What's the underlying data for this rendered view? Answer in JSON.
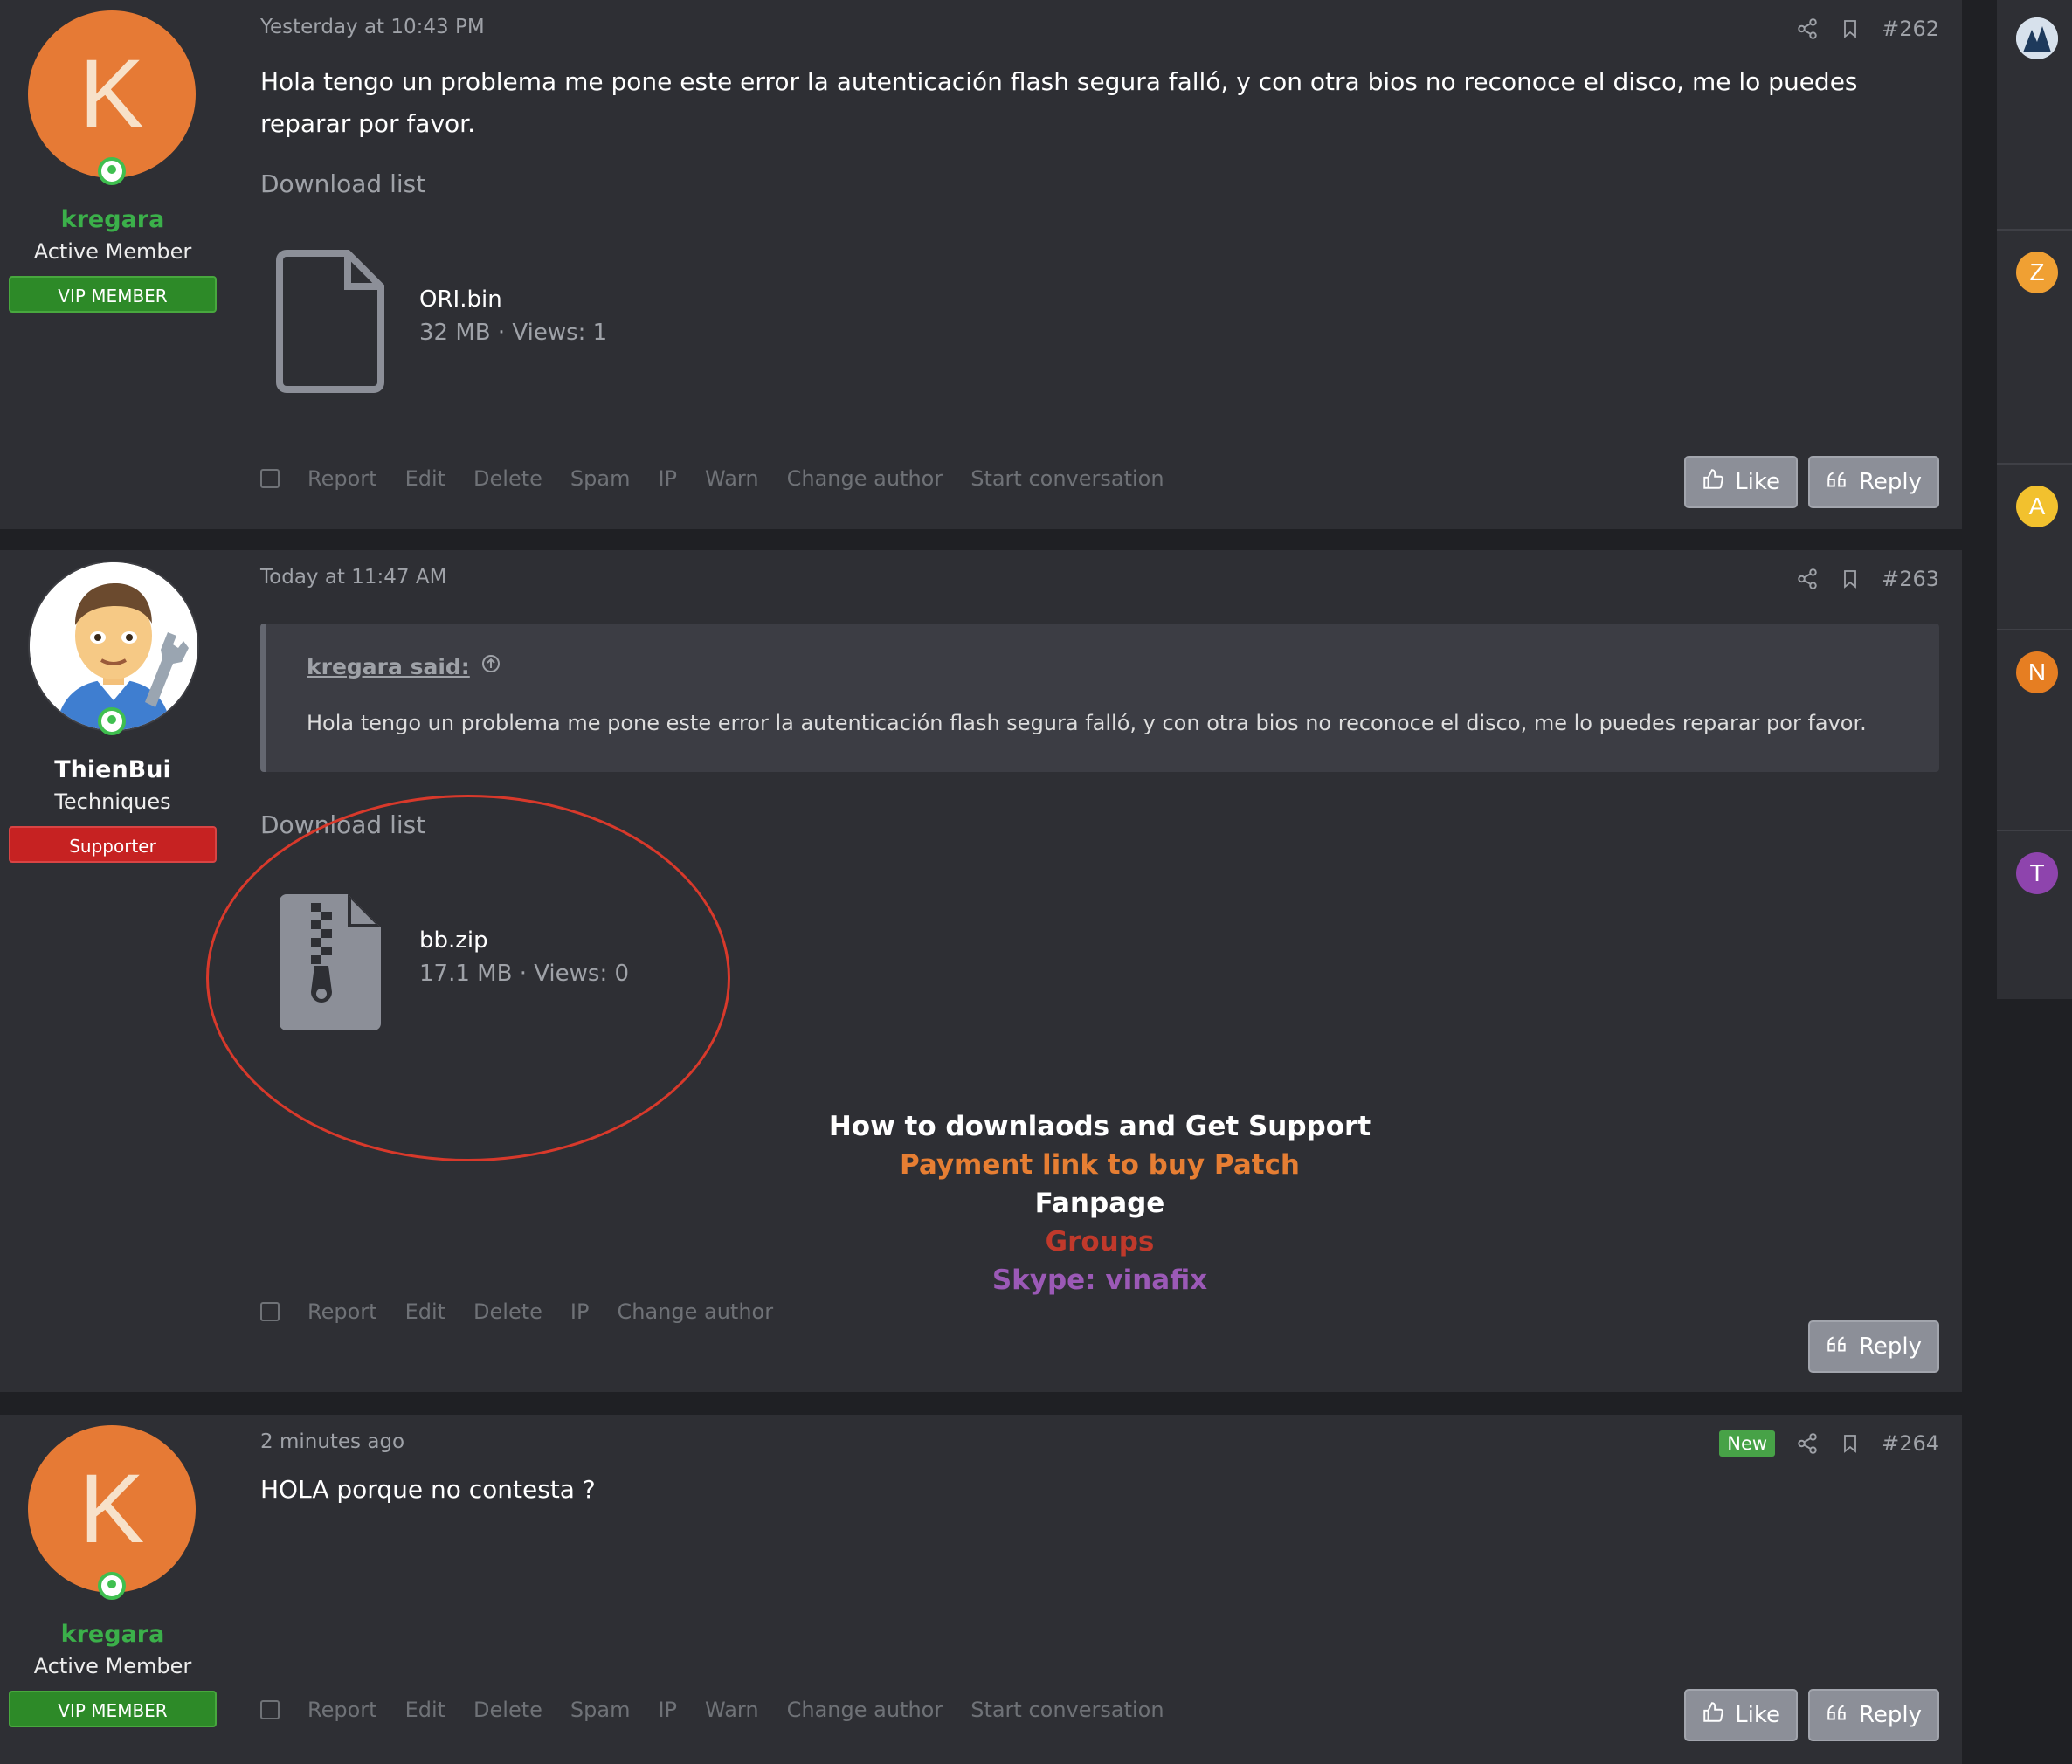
{
  "posts": [
    {
      "user": {
        "initial": "K",
        "name": "kregara",
        "title": "Active Member",
        "badge": "VIP MEMBER"
      },
      "date": "Yesterday at 10:43 PM",
      "number": "#262",
      "message": "Hola tengo un problema me pone este error la autenticación flash segura falló, y con otra bios no reconoce el disco, me lo puedes reparar por favor.",
      "download_title": "Download list",
      "attachment": {
        "name": "ORI.bin",
        "meta": "32 MB · Views: 1",
        "icon": "file-icon"
      },
      "actions": [
        "Report",
        "Edit",
        "Delete",
        "Spam",
        "IP",
        "Warn",
        "Change author",
        "Start conversation"
      ],
      "like_label": "Like",
      "reply_label": "Reply"
    },
    {
      "user": {
        "name": "ThienBui",
        "title": "Techniques",
        "badge": "Supporter"
      },
      "date": "Today at 11:47 AM",
      "number": "#263",
      "quote": {
        "author": "kregara said:",
        "text": "Hola tengo un problema me pone este error la autenticación flash segura falló, y con otra bios no reconoce el disco, me lo puedes reparar por favor."
      },
      "download_title": "Download list",
      "attachment": {
        "name": "bb.zip",
        "meta": "17.1 MB · Views: 0",
        "icon": "zip-file-icon"
      },
      "signature": [
        {
          "text": "How to downlaods and Get Support",
          "color": "#ffffff"
        },
        {
          "text": "Payment link to buy Patch",
          "color": "#e67e33"
        },
        {
          "text": "Fanpage",
          "color": "#ffffff"
        },
        {
          "text": "Groups",
          "color": "#c0392b"
        },
        {
          "text": "Skype: vinafix",
          "color": "#9b59b6"
        }
      ],
      "actions": [
        "Report",
        "Edit",
        "Delete",
        "IP",
        "Change author"
      ],
      "reply_label": "Reply"
    },
    {
      "user": {
        "initial": "K",
        "name": "kregara",
        "title": "Active Member",
        "badge": "VIP MEMBER"
      },
      "date": "2 minutes ago",
      "new_label": "New",
      "number": "#264",
      "message": "HOLA porque no contesta ?",
      "actions": [
        "Report",
        "Edit",
        "Delete",
        "Spam",
        "IP",
        "Warn",
        "Change author",
        "Start conversation"
      ],
      "like_label": "Like",
      "reply_label": "Reply"
    }
  ],
  "sidebar": {
    "items": [
      {
        "letter": "Z",
        "color": "#f0a033"
      },
      {
        "letter": "A",
        "color": "#f2c12e"
      },
      {
        "letter": "N",
        "color": "#e67e22"
      },
      {
        "letter": "T",
        "color": "#8e44ad"
      }
    ]
  }
}
